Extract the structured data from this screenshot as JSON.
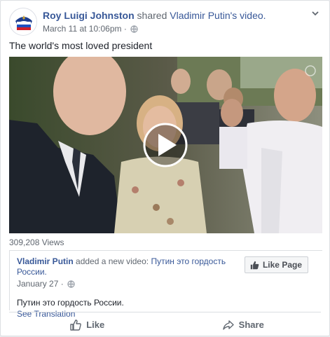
{
  "post": {
    "author": "Roy Luigi Johnston",
    "verb": "shared",
    "source": "Vladimir Putin's video.",
    "timestamp": "March 11 at 10:06pm",
    "caption": "The world's most loved president"
  },
  "video": {
    "views": "309,208 Views"
  },
  "shared_post": {
    "page_name": "Vladimir Putin",
    "added_text": "added a new video:",
    "video_title": "Путин это гордость России.",
    "date": "January 27",
    "body": "Путин это гордость России.",
    "see_translation": "See Translation",
    "like_page_label": "Like Page"
  },
  "actions": {
    "like_label": "Like",
    "share_label": "Share"
  },
  "icons": [
    "avatar-logo",
    "globe-icon",
    "chevron-down-icon",
    "play-icon",
    "thumbs-up-icon",
    "share-arrow-icon"
  ],
  "colors": {
    "link": "#385898",
    "meta": "#606770",
    "text": "#1d2129"
  }
}
